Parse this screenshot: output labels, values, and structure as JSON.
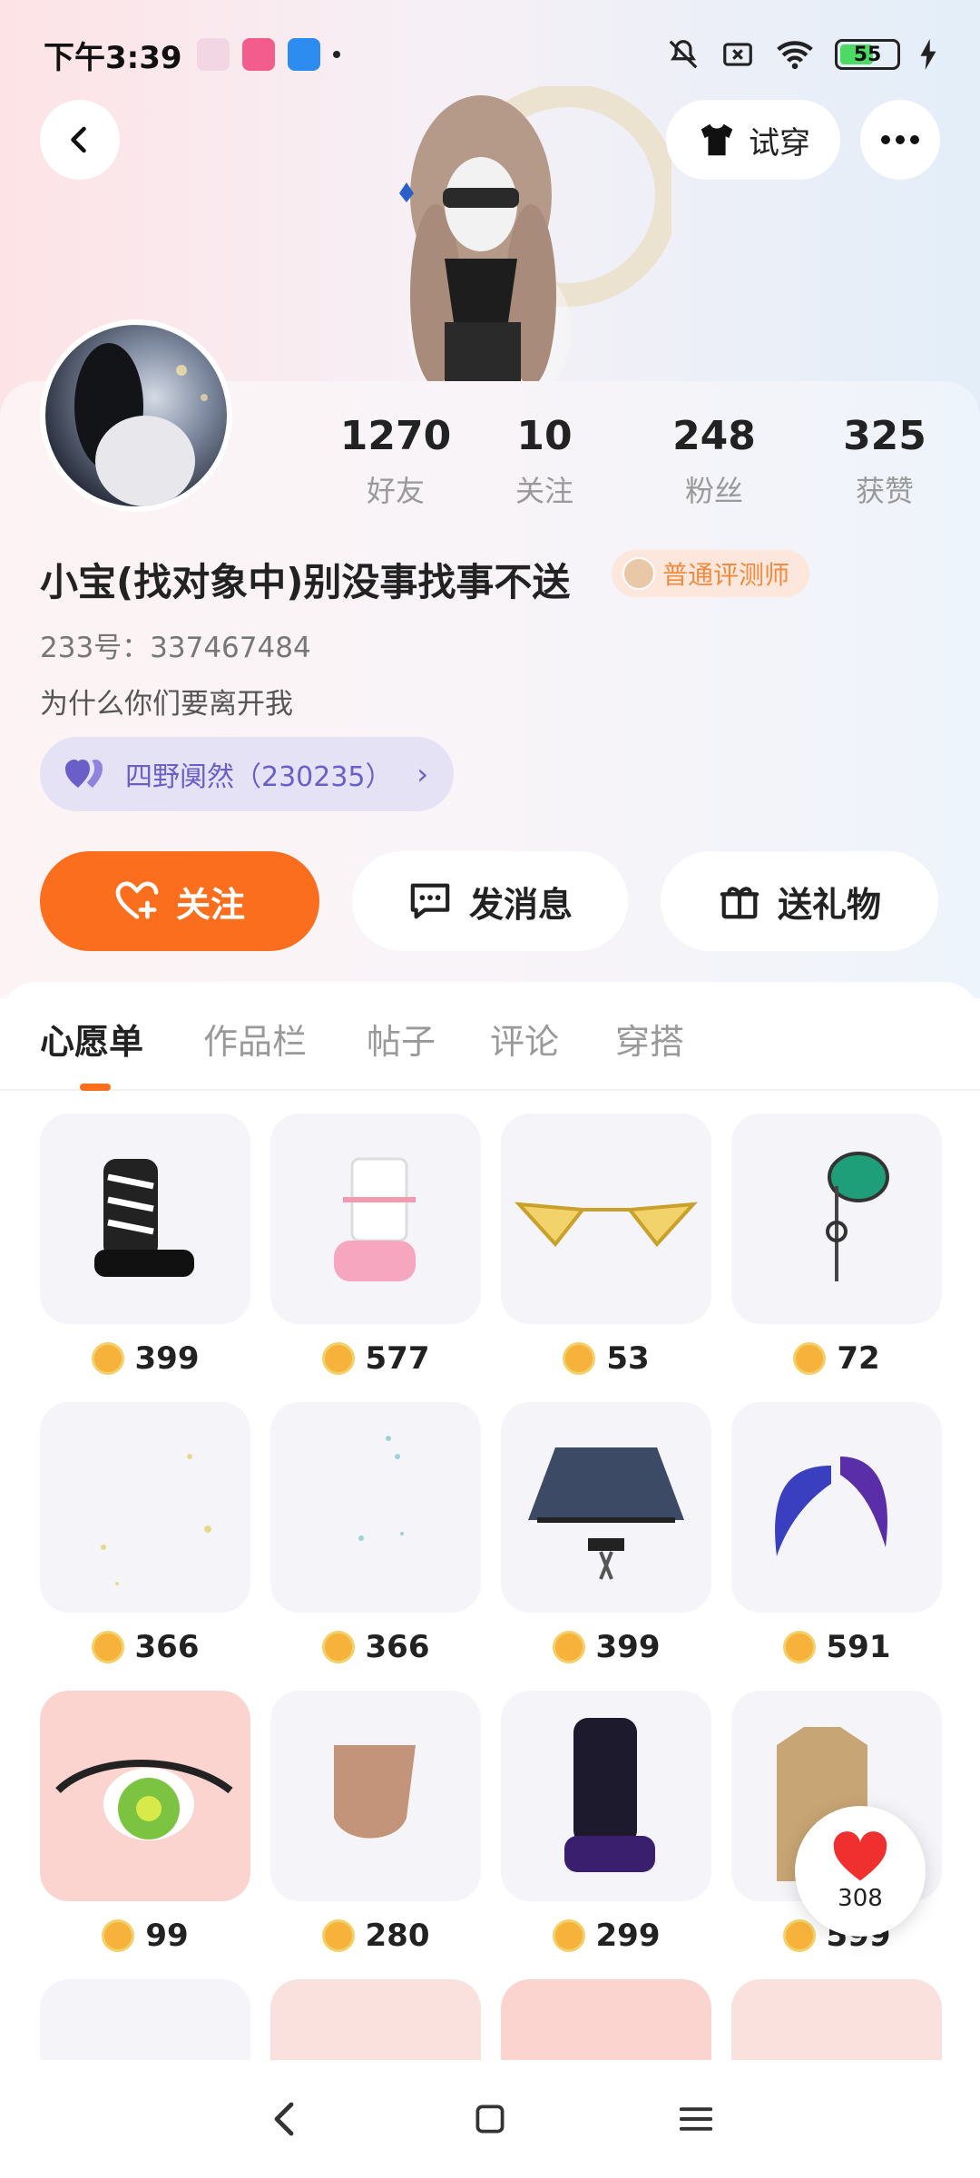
{
  "status_bar": {
    "time": "下午3:39",
    "battery": "55"
  },
  "header": {
    "try_on_label": "试穿"
  },
  "profile": {
    "stats": [
      {
        "value": "1270",
        "label": "好友"
      },
      {
        "value": "10",
        "label": "关注"
      },
      {
        "value": "248",
        "label": "粉丝"
      },
      {
        "value": "325",
        "label": "获赞"
      }
    ],
    "username": "小宝(找对象中)别没事找事不送",
    "badge": "普通评测师",
    "uid": "233号：337467484",
    "bio": "为什么你们要离开我",
    "relation_chip": "四野阒然（230235）"
  },
  "actions": {
    "follow": "关注",
    "message": "发消息",
    "gift": "送礼物"
  },
  "tabs": [
    "心愿单",
    "作品栏",
    "帖子",
    "评论",
    "穿搭"
  ],
  "items": [
    {
      "price": "399",
      "icon": "zebra-boots-icon"
    },
    {
      "price": "577",
      "icon": "pink-leg-warmers-icon"
    },
    {
      "price": "53",
      "icon": "gold-glasses-icon"
    },
    {
      "price": "72",
      "icon": "jade-earring-icon"
    },
    {
      "price": "366",
      "icon": "sparkle-effect-icon"
    },
    {
      "price": "366",
      "icon": "sparkle-effect-icon"
    },
    {
      "price": "399",
      "icon": "denim-skirt-icon"
    },
    {
      "price": "591",
      "icon": "blue-wings-icon"
    },
    {
      "price": "99",
      "icon": "green-eye-icon"
    },
    {
      "price": "280",
      "icon": "hand-icon"
    },
    {
      "price": "299",
      "icon": "purple-boots-icon"
    },
    {
      "price": "599",
      "icon": "trench-coat-icon"
    }
  ],
  "like_fab": {
    "count": "308"
  },
  "colors": {
    "accent": "#fb6e1e",
    "badge_text": "#f08a3c",
    "relation_text": "#6a5fc9"
  }
}
